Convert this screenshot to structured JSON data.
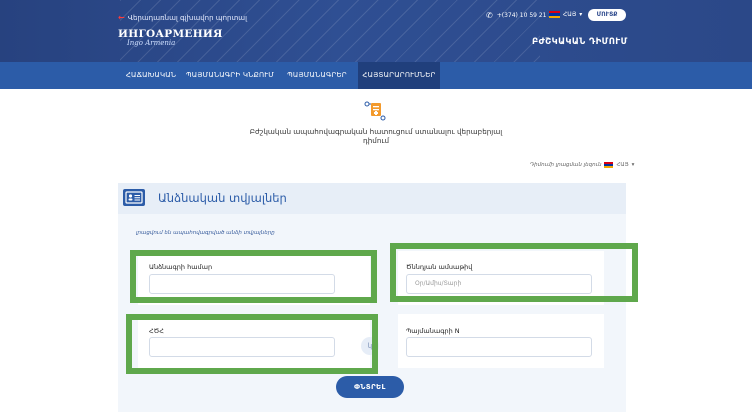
{
  "header": {
    "back_link": "Վերադառնալ գլխավոր պորտալ",
    "logo_line1": "ИНГОАРМЕНИЯ",
    "logo_line2": "Ingo Armenia",
    "phone": "+(374) 10 59 21 21",
    "language": "ՀԱՅ",
    "login_button": "ՄՈՒՏՔ",
    "doctor_call": "ԲԺՇԿԱԿԱՆ ԴԻՄՈՒՄ"
  },
  "nav": {
    "items": [
      {
        "label": "ՀԱՃԱԽԱԿԱՆ"
      },
      {
        "label": "ՊԱՅՄԱՆԱԳՐԻ ԿՆՔՈՒՄ"
      },
      {
        "label": "ՊԱՅՄԱՆԱԳՐԵՐ"
      },
      {
        "label": "ՀԱՅՏԱՐԱՐՈՒՄՆԵՐ"
      }
    ]
  },
  "page": {
    "title": "Բժշկական ապահովագրական հատուցում ստանալու վերաբերյալ դիմում",
    "language_choose_label": "Դիմումի լրացման լեզուն",
    "language_value": "ՀԱՅ"
  },
  "form": {
    "section_title": "Անձնական տվյալներ",
    "note": "լրացվում են ապահովագրված անձի տվյալները",
    "fields": {
      "passport": {
        "label": "Անձնագրի համար",
        "placeholder": ""
      },
      "birth_date": {
        "label": "Ծննդյան ամսաթիվ",
        "placeholder": "Օր/Ամիս/Տարի"
      },
      "ssn": {
        "label": "ՀԾՀ",
        "placeholder": ""
      },
      "contract": {
        "label": "Պայմանագրի N",
        "placeholder": ""
      }
    },
    "or_label": "կ",
    "submit": "ՓՆՏՐԵԼ"
  },
  "colors": {
    "header_bg": "#2a4685",
    "nav_bg": "#2c5ca8",
    "nav_active": "#203f7c",
    "highlight": "#5fa84c",
    "accent": "#2c5ca8"
  }
}
